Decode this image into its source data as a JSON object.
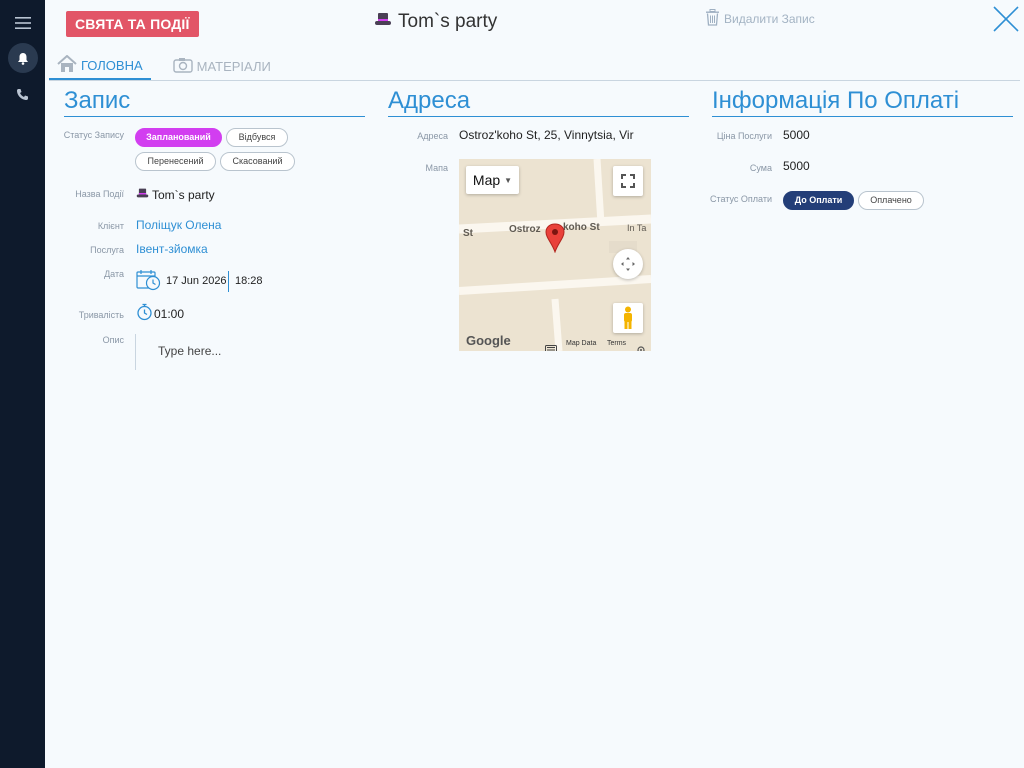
{
  "header": {
    "category": "СВЯТА ТА ПОДІЇ",
    "event_title": "Tom`s party",
    "delete_label": "Видалити Запис"
  },
  "tabs": [
    {
      "label": "ГОЛОВНА",
      "icon": "home-icon",
      "active": true
    },
    {
      "label": "МАТЕРІАЛИ",
      "icon": "camera-icon",
      "active": false
    }
  ],
  "record": {
    "title": "Запис",
    "status_label": "Статус Запису",
    "statuses": [
      "Запланований",
      "Відбувся",
      "Перенесений",
      "Скасований"
    ],
    "selected_status": "Запланований",
    "event_name_label": "Назва Події",
    "event_name": "Tom`s party",
    "client_label": "Клієнт",
    "client": "Поліщук Олена",
    "service_label": "Послуга",
    "service": "Івент-зйомка",
    "date_label": "Дата",
    "date": "17 Jun 2026",
    "time": "18:28",
    "duration_label": "Тривалість",
    "duration": "01:00",
    "description_label": "Опис",
    "description_placeholder": "Type here..."
  },
  "address": {
    "title": "Адреса",
    "address_label": "Адреса",
    "address": "Ostroz'koho St, 25, Vinnytsia, Vir",
    "map_label": "Мапа",
    "map": {
      "type_button": "Map",
      "street1": "Ostroz",
      "street2": "koho St",
      "street_left": "St",
      "poi": "In Ta",
      "attribution": "Google",
      "map_data": "Map Data",
      "terms": "Terms"
    }
  },
  "payment": {
    "title": "Інформація По Оплаті",
    "price_label": "Ціна Послуги",
    "price": "5000",
    "sum_label": "Сума",
    "sum": "5000",
    "status_label": "Статус Оплати",
    "statuses": [
      "До Оплати",
      "Оплачено"
    ],
    "selected_status": "До Оплати"
  },
  "colors": {
    "accent": "#2e8fd4",
    "category_badge": "#e25567",
    "status_planned": "#d23ef0",
    "status_to_pay": "#233e78",
    "rail": "#0e1a2c"
  }
}
